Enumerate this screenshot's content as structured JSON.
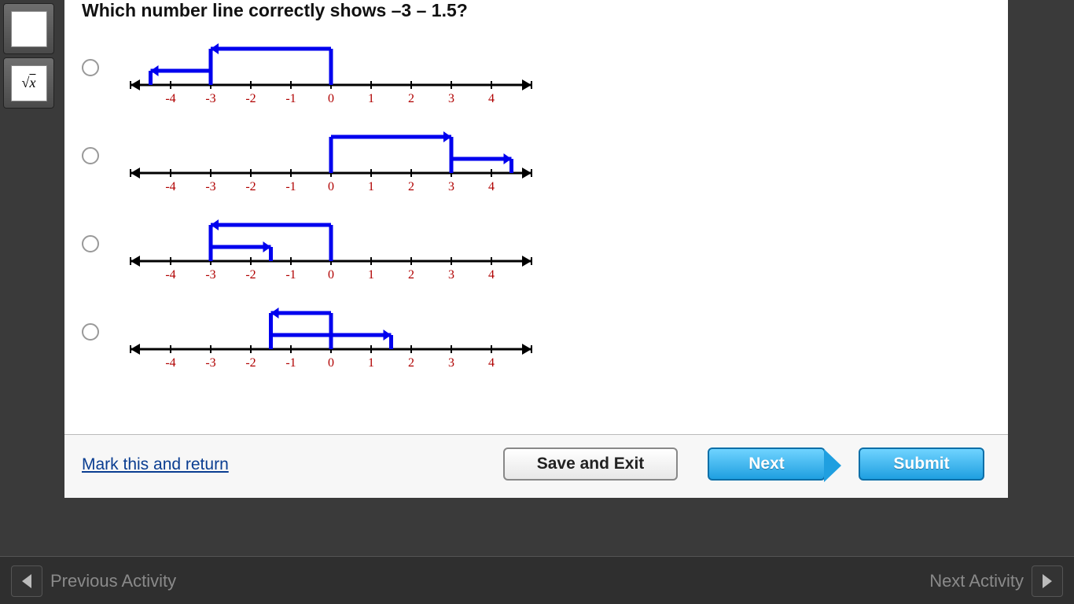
{
  "question_text": "Which number line correctly shows –3 – 1.5?",
  "tool_label": "√x",
  "axis": {
    "min": -5,
    "max": 5,
    "labels": [
      -4,
      -3,
      -2,
      -1,
      0,
      1,
      2,
      3,
      4
    ]
  },
  "options": [
    {
      "id": "A",
      "arrows": [
        {
          "from": 0,
          "to": -3,
          "y": 1
        },
        {
          "from": -3,
          "to": -4.5,
          "y": 0
        }
      ]
    },
    {
      "id": "B",
      "arrows": [
        {
          "from": 0,
          "to": 3,
          "y": 1
        },
        {
          "from": 3,
          "to": 4.5,
          "y": 0
        }
      ]
    },
    {
      "id": "C",
      "arrows": [
        {
          "from": 0,
          "to": -3,
          "y": 1
        },
        {
          "from": -3,
          "to": -1.5,
          "y": 0
        }
      ]
    },
    {
      "id": "D",
      "arrows": [
        {
          "from": -1.5,
          "to": 1.5,
          "y": 0
        },
        {
          "from": 1.5,
          "to": -1.5,
          "y": 1,
          "startFrom": 0
        }
      ]
    }
  ],
  "option_d_arrows": [
    {
      "from": -1.5,
      "to": 1.5,
      "y": 0
    },
    {
      "from": 0,
      "to": -1.5,
      "y": 1
    }
  ],
  "buttons": {
    "mark": "Mark this and return",
    "save": "Save and Exit",
    "next": "Next",
    "submit": "Submit"
  },
  "footer": {
    "prev": "Previous Activity",
    "next": "Next Activity"
  },
  "colors": {
    "arrow": "#0000ee",
    "axis": "#000",
    "label": "#b00000"
  }
}
